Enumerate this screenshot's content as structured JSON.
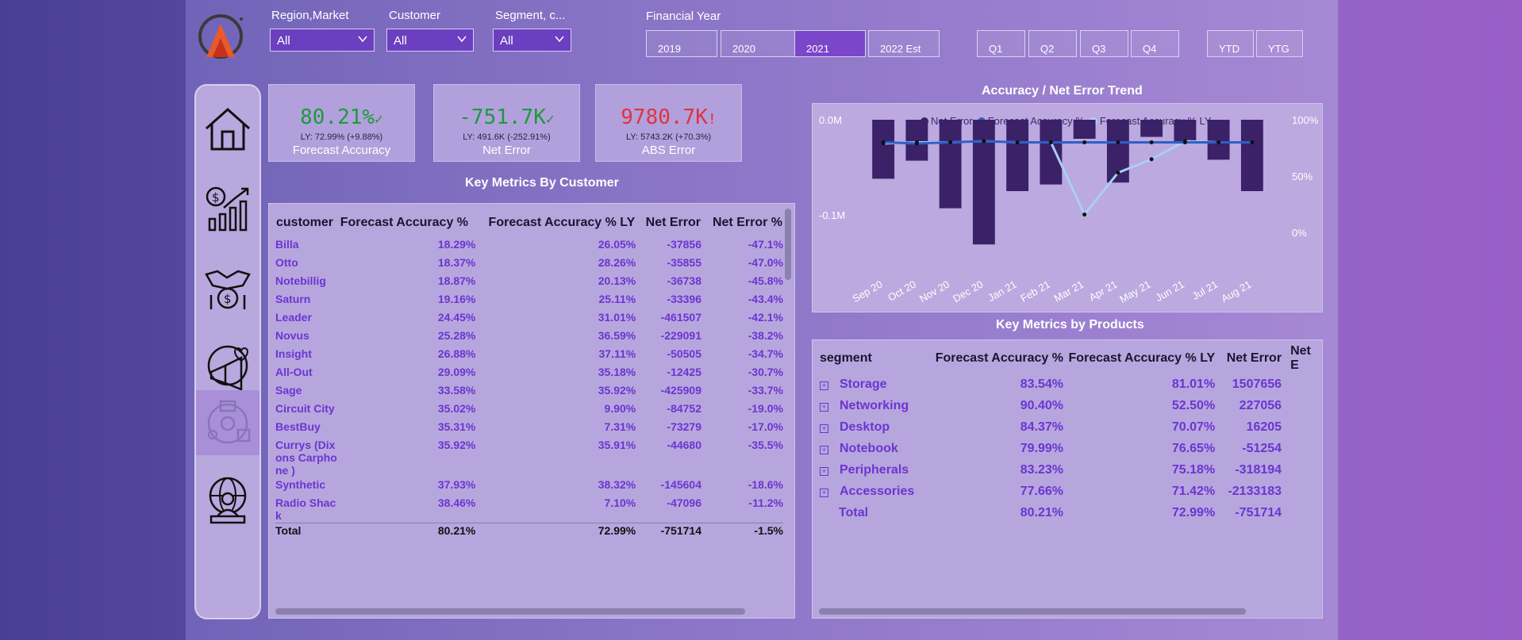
{
  "filters": {
    "region": {
      "label": "Region,Market",
      "value": "All"
    },
    "customer": {
      "label": "Customer",
      "value": "All"
    },
    "segment": {
      "label": "Segment, c...",
      "value": "All"
    }
  },
  "financial_year": {
    "title": "Financial Year",
    "years": [
      "2019",
      "2020",
      "2021",
      "2022 Est"
    ],
    "selected_year": "2021",
    "quarters": [
      "Q1",
      "Q2",
      "Q3",
      "Q4"
    ],
    "periods": [
      "YTD",
      "YTG"
    ]
  },
  "nav": [
    "home-icon",
    "sales-growth-icon",
    "finance-handshake-icon",
    "marketing-icon",
    "supply-chain-icon",
    "executive-icon"
  ],
  "kpis": [
    {
      "value": "80.21%",
      "mark": "✓",
      "ly": "LY: 72.99% (+9.88%)",
      "name": "Forecast Accuracy",
      "color": "#1c9a3c"
    },
    {
      "value": "-751.7K",
      "mark": "✓",
      "ly": "LY: 491.6K (-252.91%)",
      "name": "Net Error",
      "color": "#1c9a3c"
    },
    {
      "value": "9780.7K",
      "mark": "!",
      "ly": "LY: 5743.2K (+70.3%)",
      "name": "ABS Error",
      "color": "#e0333f"
    }
  ],
  "customer_table": {
    "title": "Key Metrics By Customer",
    "columns": [
      "customer",
      "Forecast Accuracy %",
      "Forecast Accuracy % LY",
      "Net Error",
      "Net Error %"
    ],
    "rows": [
      [
        "Billa",
        "18.29%",
        "26.05%",
        "-37856",
        "-47.1%"
      ],
      [
        "Otto",
        "18.37%",
        "28.26%",
        "-35855",
        "-47.0%"
      ],
      [
        "Notebillig",
        "18.87%",
        "20.13%",
        "-36738",
        "-45.8%"
      ],
      [
        "Saturn",
        "19.16%",
        "25.11%",
        "-33396",
        "-43.4%"
      ],
      [
        "Leader",
        "24.45%",
        "31.01%",
        "-461507",
        "-42.1%"
      ],
      [
        "Novus",
        "25.28%",
        "36.59%",
        "-229091",
        "-38.2%"
      ],
      [
        "Insight",
        "26.88%",
        "37.11%",
        "-50505",
        "-34.7%"
      ],
      [
        "All-Out",
        "29.09%",
        "35.18%",
        "-12425",
        "-30.7%"
      ],
      [
        "Sage",
        "33.58%",
        "35.92%",
        "-425909",
        "-33.7%"
      ],
      [
        "Circuit City",
        "35.02%",
        "9.90%",
        "-84752",
        "-19.0%"
      ],
      [
        "BestBuy",
        "35.31%",
        "7.31%",
        "-73279",
        "-17.0%"
      ],
      [
        "Currys (Dixons Carphone )",
        "35.92%",
        "35.91%",
        "-44680",
        "-35.5%"
      ],
      [
        "Synthetic",
        "37.93%",
        "38.32%",
        "-145604",
        "-18.6%"
      ],
      [
        "Radio Shack",
        "38.46%",
        "7.10%",
        "-47096",
        "-11.2%"
      ]
    ],
    "total": [
      "Total",
      "80.21%",
      "72.99%",
      "-751714",
      "-1.5%"
    ]
  },
  "trend_chart": {
    "title": "Accuracy / Net Error Trend"
  },
  "chart_data": {
    "type": "bar",
    "title": "Accuracy / Net Error Trend",
    "categories": [
      "Sep 20",
      "Oct 20",
      "Nov 20",
      "Dec 20",
      "Jan 21",
      "Feb 21",
      "Mar 21",
      "Apr 21",
      "May 21",
      "Jun 21",
      "Jul 21",
      "Aug 21"
    ],
    "series": [
      {
        "name": "Net Error",
        "axis": "left",
        "values": [
          -0.062,
          -0.043,
          -0.093,
          -0.131,
          -0.075,
          -0.068,
          -0.02,
          -0.066,
          -0.018,
          -0.023,
          -0.042,
          -0.075
        ],
        "color": "#3b2168"
      },
      {
        "name": "Forecast Accuracy %",
        "axis": "right",
        "values": [
          80,
          79,
          80,
          81,
          80,
          80,
          80,
          80,
          80,
          80,
          80,
          80
        ],
        "color": "#2f5fc9"
      },
      {
        "name": "Forecast Accuracy % LY",
        "axis": "right",
        "values": [
          79,
          80,
          80,
          81,
          80,
          80,
          16,
          53,
          65,
          81,
          80,
          80
        ],
        "color": "#a8d0f5"
      }
    ],
    "y_left_ticks": [
      "0.0M",
      "-0.1M"
    ],
    "y_right_ticks": [
      "100%",
      "50%",
      "0%"
    ],
    "ylim_left": [
      -0.15,
      0.0
    ],
    "ylim_right": [
      0,
      100
    ],
    "legend": "top"
  },
  "product_table": {
    "title": "Key Metrics by Products",
    "columns": [
      "segment",
      "Forecast Accuracy %",
      "Forecast Accuracy % LY",
      "Net Error",
      "Net E"
    ],
    "rows": [
      [
        "Storage",
        "83.54%",
        "81.01%",
        "1507656"
      ],
      [
        "Networking",
        "90.40%",
        "52.50%",
        "227056"
      ],
      [
        "Desktop",
        "84.37%",
        "70.07%",
        "16205"
      ],
      [
        "Notebook",
        "79.99%",
        "76.65%",
        "-51254"
      ],
      [
        "Peripherals",
        "83.23%",
        "75.18%",
        "-318194"
      ],
      [
        "Accessories",
        "77.66%",
        "71.42%",
        "-2133183"
      ]
    ],
    "total": [
      "Total",
      "80.21%",
      "72.99%",
      "-751714"
    ]
  }
}
